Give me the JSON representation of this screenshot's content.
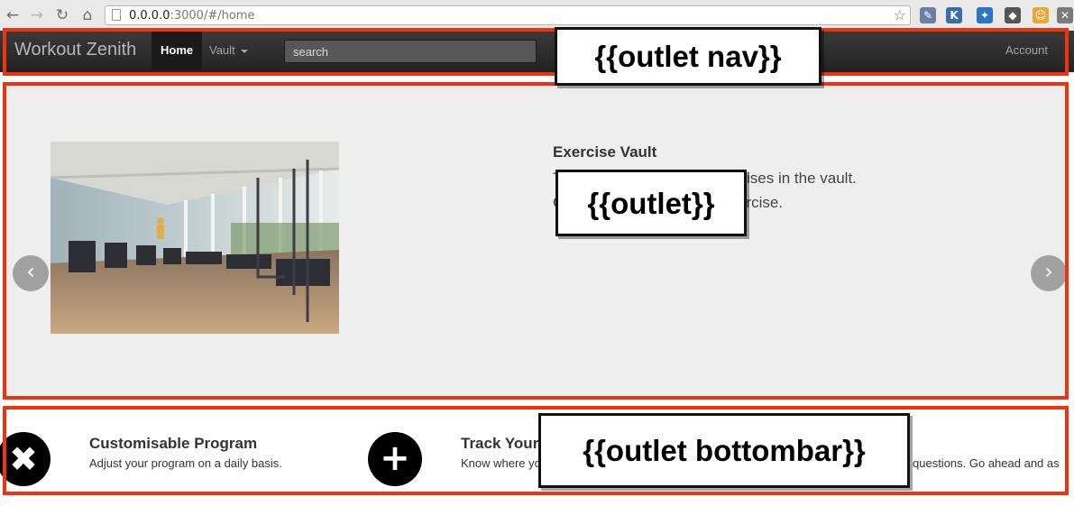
{
  "browser": {
    "url_host": "0.0.0.0",
    "url_rest": ":3000/#/home",
    "back_icon": "←",
    "forward_icon": "→",
    "reload_icon": "↻",
    "home_icon": "⌂",
    "star_icon": "☆",
    "extensions": [
      {
        "name": "eyedropper-icon",
        "glyph": "✎",
        "color": "#6b7fa3"
      },
      {
        "name": "k-extension-icon",
        "glyph": "K",
        "color": "#3b6ea5"
      },
      {
        "name": "pin-extension-icon",
        "glyph": "✦",
        "color": "#2c74c6"
      },
      {
        "name": "evernote-icon",
        "glyph": "◆",
        "color": "#555555"
      },
      {
        "name": "cookie-extension-icon",
        "glyph": "☺",
        "color": "#e3a93a"
      },
      {
        "name": "wrench-icon",
        "glyph": "✕",
        "color": "#7a7a7a"
      }
    ]
  },
  "navbar": {
    "brand": "Workout Zenith",
    "home": "Home",
    "vault": "Vault",
    "search_placeholder": "search",
    "account": "Account"
  },
  "hero": {
    "title": "Exercise Vault",
    "line1": "T",
    "line1_tail": "ises in the vault.",
    "line2": "C",
    "line2_tail": "ercise.",
    "prev_icon": "‹",
    "next_icon": "›"
  },
  "bottombar": {
    "feature1": {
      "title": "Customisable Program",
      "text": "Adjust your program on a daily basis.",
      "icon": "✖"
    },
    "feature2": {
      "title": "Track Your",
      "text": "Know where yo",
      "icon": "+"
    },
    "feature3_text": "questions. Go ahead and as"
  },
  "annotations": {
    "nav": "{{outlet nav}}",
    "main": "{{outlet}}",
    "bottombar": "{{outlet bottombar}}"
  },
  "colors": {
    "outline_red": "#f0320f",
    "navbar_dark": "#2a2a2a",
    "hero_bg": "#eeeeee"
  }
}
